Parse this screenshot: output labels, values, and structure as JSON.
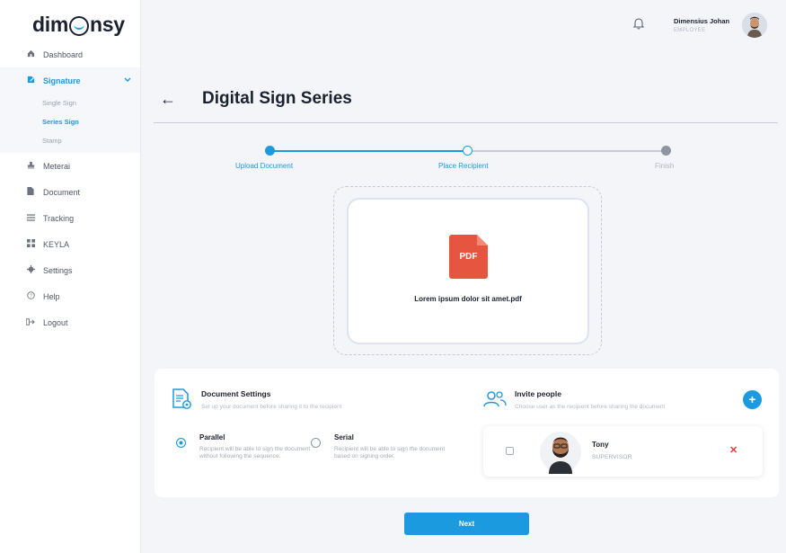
{
  "app": {
    "logo_before": "dim",
    "logo_after": "nsy"
  },
  "sidebar": {
    "items": [
      {
        "label": "Dashboard",
        "icon": "home-icon"
      },
      {
        "label": "Signature",
        "icon": "signature-icon"
      },
      {
        "label": "Meterai",
        "icon": "stamp-duty-icon"
      },
      {
        "label": "Document",
        "icon": "document-icon"
      },
      {
        "label": "Tracking",
        "icon": "list-icon"
      },
      {
        "label": "KEYLA",
        "icon": "grid-icon"
      },
      {
        "label": "Settings",
        "icon": "gear-icon"
      },
      {
        "label": "Help",
        "icon": "help-icon"
      },
      {
        "label": "Logout",
        "icon": "logout-icon"
      }
    ],
    "signature_sub": [
      {
        "label": "Single Sign"
      },
      {
        "label": "Series Sign"
      },
      {
        "label": "Stamp"
      }
    ]
  },
  "header": {
    "user_name": "Dimensius Johan",
    "user_role": "EMPLOYEE"
  },
  "page": {
    "title": "Digital Sign Series",
    "back_icon": "←"
  },
  "stepper": {
    "steps": [
      {
        "label": "Upload Document",
        "state": "done"
      },
      {
        "label": "Place Recipient",
        "state": "current"
      },
      {
        "label": "Finish",
        "state": "pending"
      }
    ]
  },
  "upload": {
    "file_type": "PDF",
    "file_name": "Lorem ipsum dolor sit amet.pdf"
  },
  "document_settings": {
    "title": "Document Settings",
    "subtitle": "Set up your document before sharing it to the recipient",
    "options": [
      {
        "title": "Parallel",
        "desc": "Recipient will be able to sign the document without following the sequence.",
        "selected": true
      },
      {
        "title": "Serial",
        "desc": "Recipient will be able to sign the document based on signing order.",
        "selected": false
      }
    ]
  },
  "invite": {
    "title": "Invite people",
    "subtitle": "Choose user as the recipient before sharing the document",
    "add_label": "+",
    "people": [
      {
        "name": "Tony",
        "role": "SUPERVISOR",
        "remove_label": "✕"
      }
    ]
  },
  "actions": {
    "next_label": "Next"
  },
  "colors": {
    "accent": "#1c9ae0",
    "pdf_red": "#e6553f",
    "remove_red": "#e23a3a"
  }
}
